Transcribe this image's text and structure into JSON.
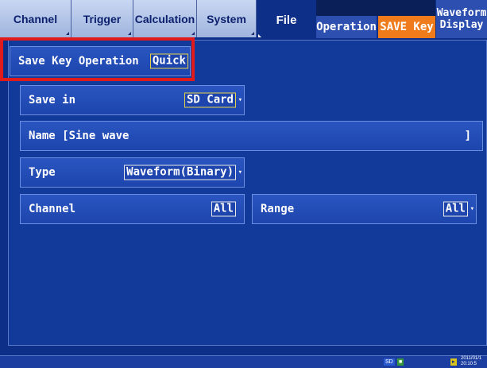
{
  "tabs": {
    "channel": "Channel",
    "trigger": "Trigger",
    "calculation": "Calculation",
    "system": "System",
    "file": "File"
  },
  "subtabs": {
    "operation": "Operation",
    "save_key": "SAVE Key",
    "waveform_line1": "Waveform",
    "waveform_line2": "Display"
  },
  "settings": {
    "save_key_operation": {
      "label": "Save Key Operation",
      "value": "Quick"
    },
    "save_in": {
      "label": "Save in",
      "value": "SD Card"
    },
    "name": {
      "label": "Name [Sine wave",
      "close": "]"
    },
    "type": {
      "label": "Type",
      "value": "Waveform(Binary)"
    },
    "channel": {
      "label": "Channel",
      "value": "All"
    },
    "range": {
      "label": "Range",
      "value": "All"
    }
  },
  "status": {
    "sd": "SD",
    "date_line1": "2011/01/1",
    "date_line2": "20:10:5"
  },
  "colors": {
    "background": "#0d2f88",
    "highlight": "#e11b1b",
    "active_subtab": "#f07b1a"
  }
}
